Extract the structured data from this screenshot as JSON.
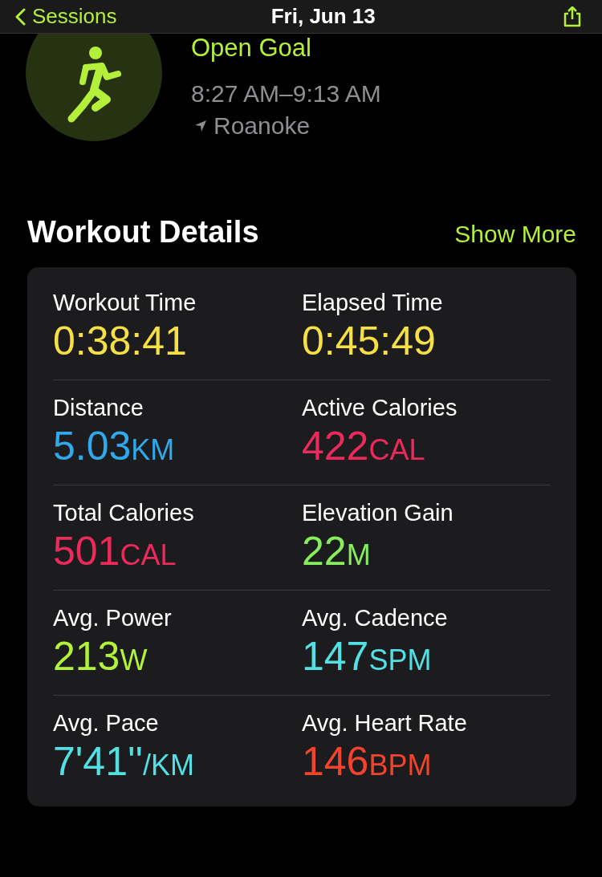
{
  "nav": {
    "back_label": "Sessions",
    "title": "Fri, Jun 13"
  },
  "workout": {
    "goal": "Open Goal",
    "time_range": "8:27 AM–9:13 AM",
    "location": "Roanoke"
  },
  "details": {
    "title": "Workout Details",
    "action": "Show More",
    "metrics": [
      {
        "label": "Workout Time",
        "value": "0:38:41",
        "color": "#f6e045"
      },
      {
        "label": "Elapsed Time",
        "value": "0:45:49",
        "color": "#f6e045"
      },
      {
        "label": "Distance",
        "value": "5.03",
        "unit": "KM",
        "color": "#2fa9ec"
      },
      {
        "label": "Active Calories",
        "value": "422",
        "unit": "CAL",
        "color": "#ea2a5c"
      },
      {
        "label": "Total Calories",
        "value": "501",
        "unit": "CAL",
        "color": "#ea2a5c"
      },
      {
        "label": "Elevation Gain",
        "value": "22",
        "unit": "M",
        "color": "#86ee5c"
      },
      {
        "label": "Avg. Power",
        "value": "213",
        "unit": "W",
        "color": "#b2f23a"
      },
      {
        "label": "Avg. Cadence",
        "value": "147",
        "unit": "SPM",
        "color": "#52e0e4"
      },
      {
        "label": "Avg. Pace",
        "value": "7'41''",
        "unit": "/KM",
        "color": "#52e0e4"
      },
      {
        "label": "Avg. Heart Rate",
        "value": "146",
        "unit": "BPM",
        "color": "#f2432c"
      }
    ]
  }
}
